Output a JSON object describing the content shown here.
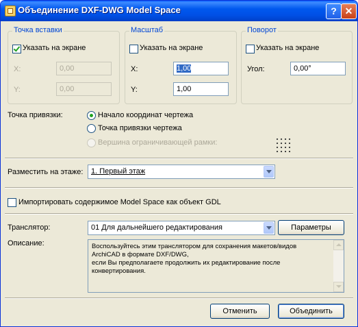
{
  "window": {
    "title": "Объединение DXF-DWG Model Space",
    "help_glyph": "?",
    "close_glyph": "✕"
  },
  "insertion_point": {
    "title": "Точка вставки",
    "specify_on_screen": "Указать на экране",
    "specify_checked": true,
    "x_label": "X:",
    "x_value": "0,00",
    "y_label": "Y:",
    "y_value": "0,00"
  },
  "scale": {
    "title": "Масштаб",
    "specify_on_screen": "Указать на экране",
    "specify_checked": false,
    "x_label": "X:",
    "x_value": "1,00",
    "y_label": "Y:",
    "y_value": "1,00"
  },
  "rotation": {
    "title": "Поворот",
    "specify_on_screen": "Указать на экране",
    "specify_checked": false,
    "angle_label": "Угол:",
    "angle_value": "0,00°"
  },
  "anchor": {
    "label": "Точка привязки:",
    "options": [
      "Начало координат чертежа",
      "Точка привязки чертежа",
      "Вершина ограничивающей рамки:"
    ],
    "selected_index": 0
  },
  "floor": {
    "label": "Разместить на этаже:",
    "value": "1. Первый этаж"
  },
  "gdl": {
    "label": "Импортировать содержимое Model Space как объект GDL",
    "checked": false
  },
  "translator": {
    "label": "Транслятор:",
    "value": "01 Для дальнейшего редактирования",
    "params_button": "Параметры"
  },
  "description": {
    "label": "Описание:",
    "lines": [
      "Воспользуйтесь этим транслятором для сохранения макетов/видов",
      "ArchiCAD в формате DXF/DWG,",
      "если Вы предполагаете продолжить их редактирование после",
      "конвертирования."
    ]
  },
  "buttons": {
    "cancel": "Отменить",
    "ok": "Объединить"
  },
  "colors": {
    "title_bar": "#0050e6",
    "group_title": "#0046d5",
    "dialog_bg": "#ece9d8",
    "check_mark": "#21a121"
  }
}
